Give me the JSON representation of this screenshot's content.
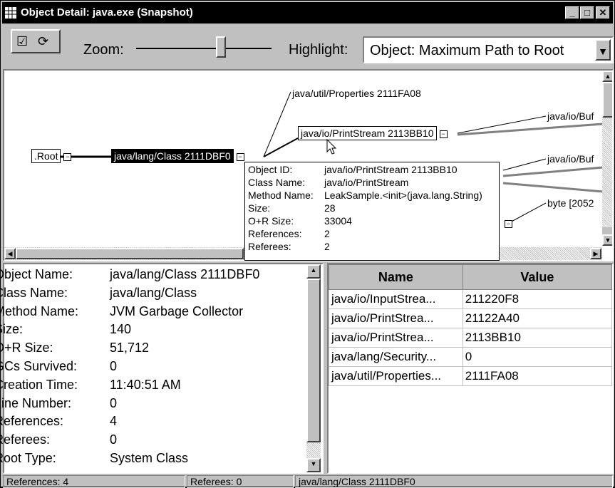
{
  "window": {
    "title": "Object Detail: java.exe (Snapshot)",
    "minimize": "_",
    "maximize": "□",
    "close": "✕"
  },
  "toolbar": {
    "zoom_label": "Zoom:",
    "highlight_label": "Highlight:",
    "highlight_value": "Object: Maximum Path to Root"
  },
  "graph": {
    "nodes": {
      "root": ".Root",
      "class": "java/lang/Class 2111DBF0",
      "properties": "java/util/Properties 2111FA08",
      "printstream": "java/io/PrintStream 2113BB10",
      "buf1": "java/io/Buf",
      "buf2": "java/io/Buf",
      "byte": "byte [2052"
    },
    "tooltip": {
      "object_id_label": "Object ID:",
      "object_id": "java/io/PrintStream 2113BB10",
      "class_name_label": "Class Name:",
      "class_name": "java/io/PrintStream",
      "method_name_label": "Method Name:",
      "method_name": "LeakSample.<init>(java.lang.String)",
      "size_label": "Size:",
      "size": "28",
      "or_size_label": "O+R Size:",
      "or_size": "33004",
      "references_label": "References:",
      "references": "2",
      "referees_label": "Referees:",
      "referees": "2"
    }
  },
  "detail": {
    "rows": [
      {
        "label": "Object Name:",
        "value": "java/lang/Class 2111DBF0"
      },
      {
        "label": "Class Name:",
        "value": "java/lang/Class"
      },
      {
        "label": "Method Name:",
        "value": "JVM Garbage Collector"
      },
      {
        "label": "Size:",
        "value": "140"
      },
      {
        "label": "O+R Size:",
        "value": "51,712"
      },
      {
        "label": "GCs Survived:",
        "value": "0"
      },
      {
        "label": "Creation Time:",
        "value": "11:40:51 AM"
      },
      {
        "label": "Line Number:",
        "value": "0"
      },
      {
        "label": "References:",
        "value": "4"
      },
      {
        "label": "Referees:",
        "value": "0"
      },
      {
        "label": "Root Type:",
        "value": "System Class"
      }
    ]
  },
  "references_table": {
    "headers": [
      "Name",
      "Value"
    ],
    "rows": [
      [
        "java/io/InputStrea...",
        "211220F8"
      ],
      [
        "java/io/PrintStrea...",
        "21122A40"
      ],
      [
        "java/io/PrintStrea...",
        "2113BB10"
      ],
      [
        "java/lang/Security...",
        "0"
      ],
      [
        "java/util/Properties...",
        "2111FA08"
      ]
    ]
  },
  "statusbar": {
    "references": "References: 4",
    "referees": "Referees: 0",
    "object": "java/lang/Class 2111DBF0"
  }
}
